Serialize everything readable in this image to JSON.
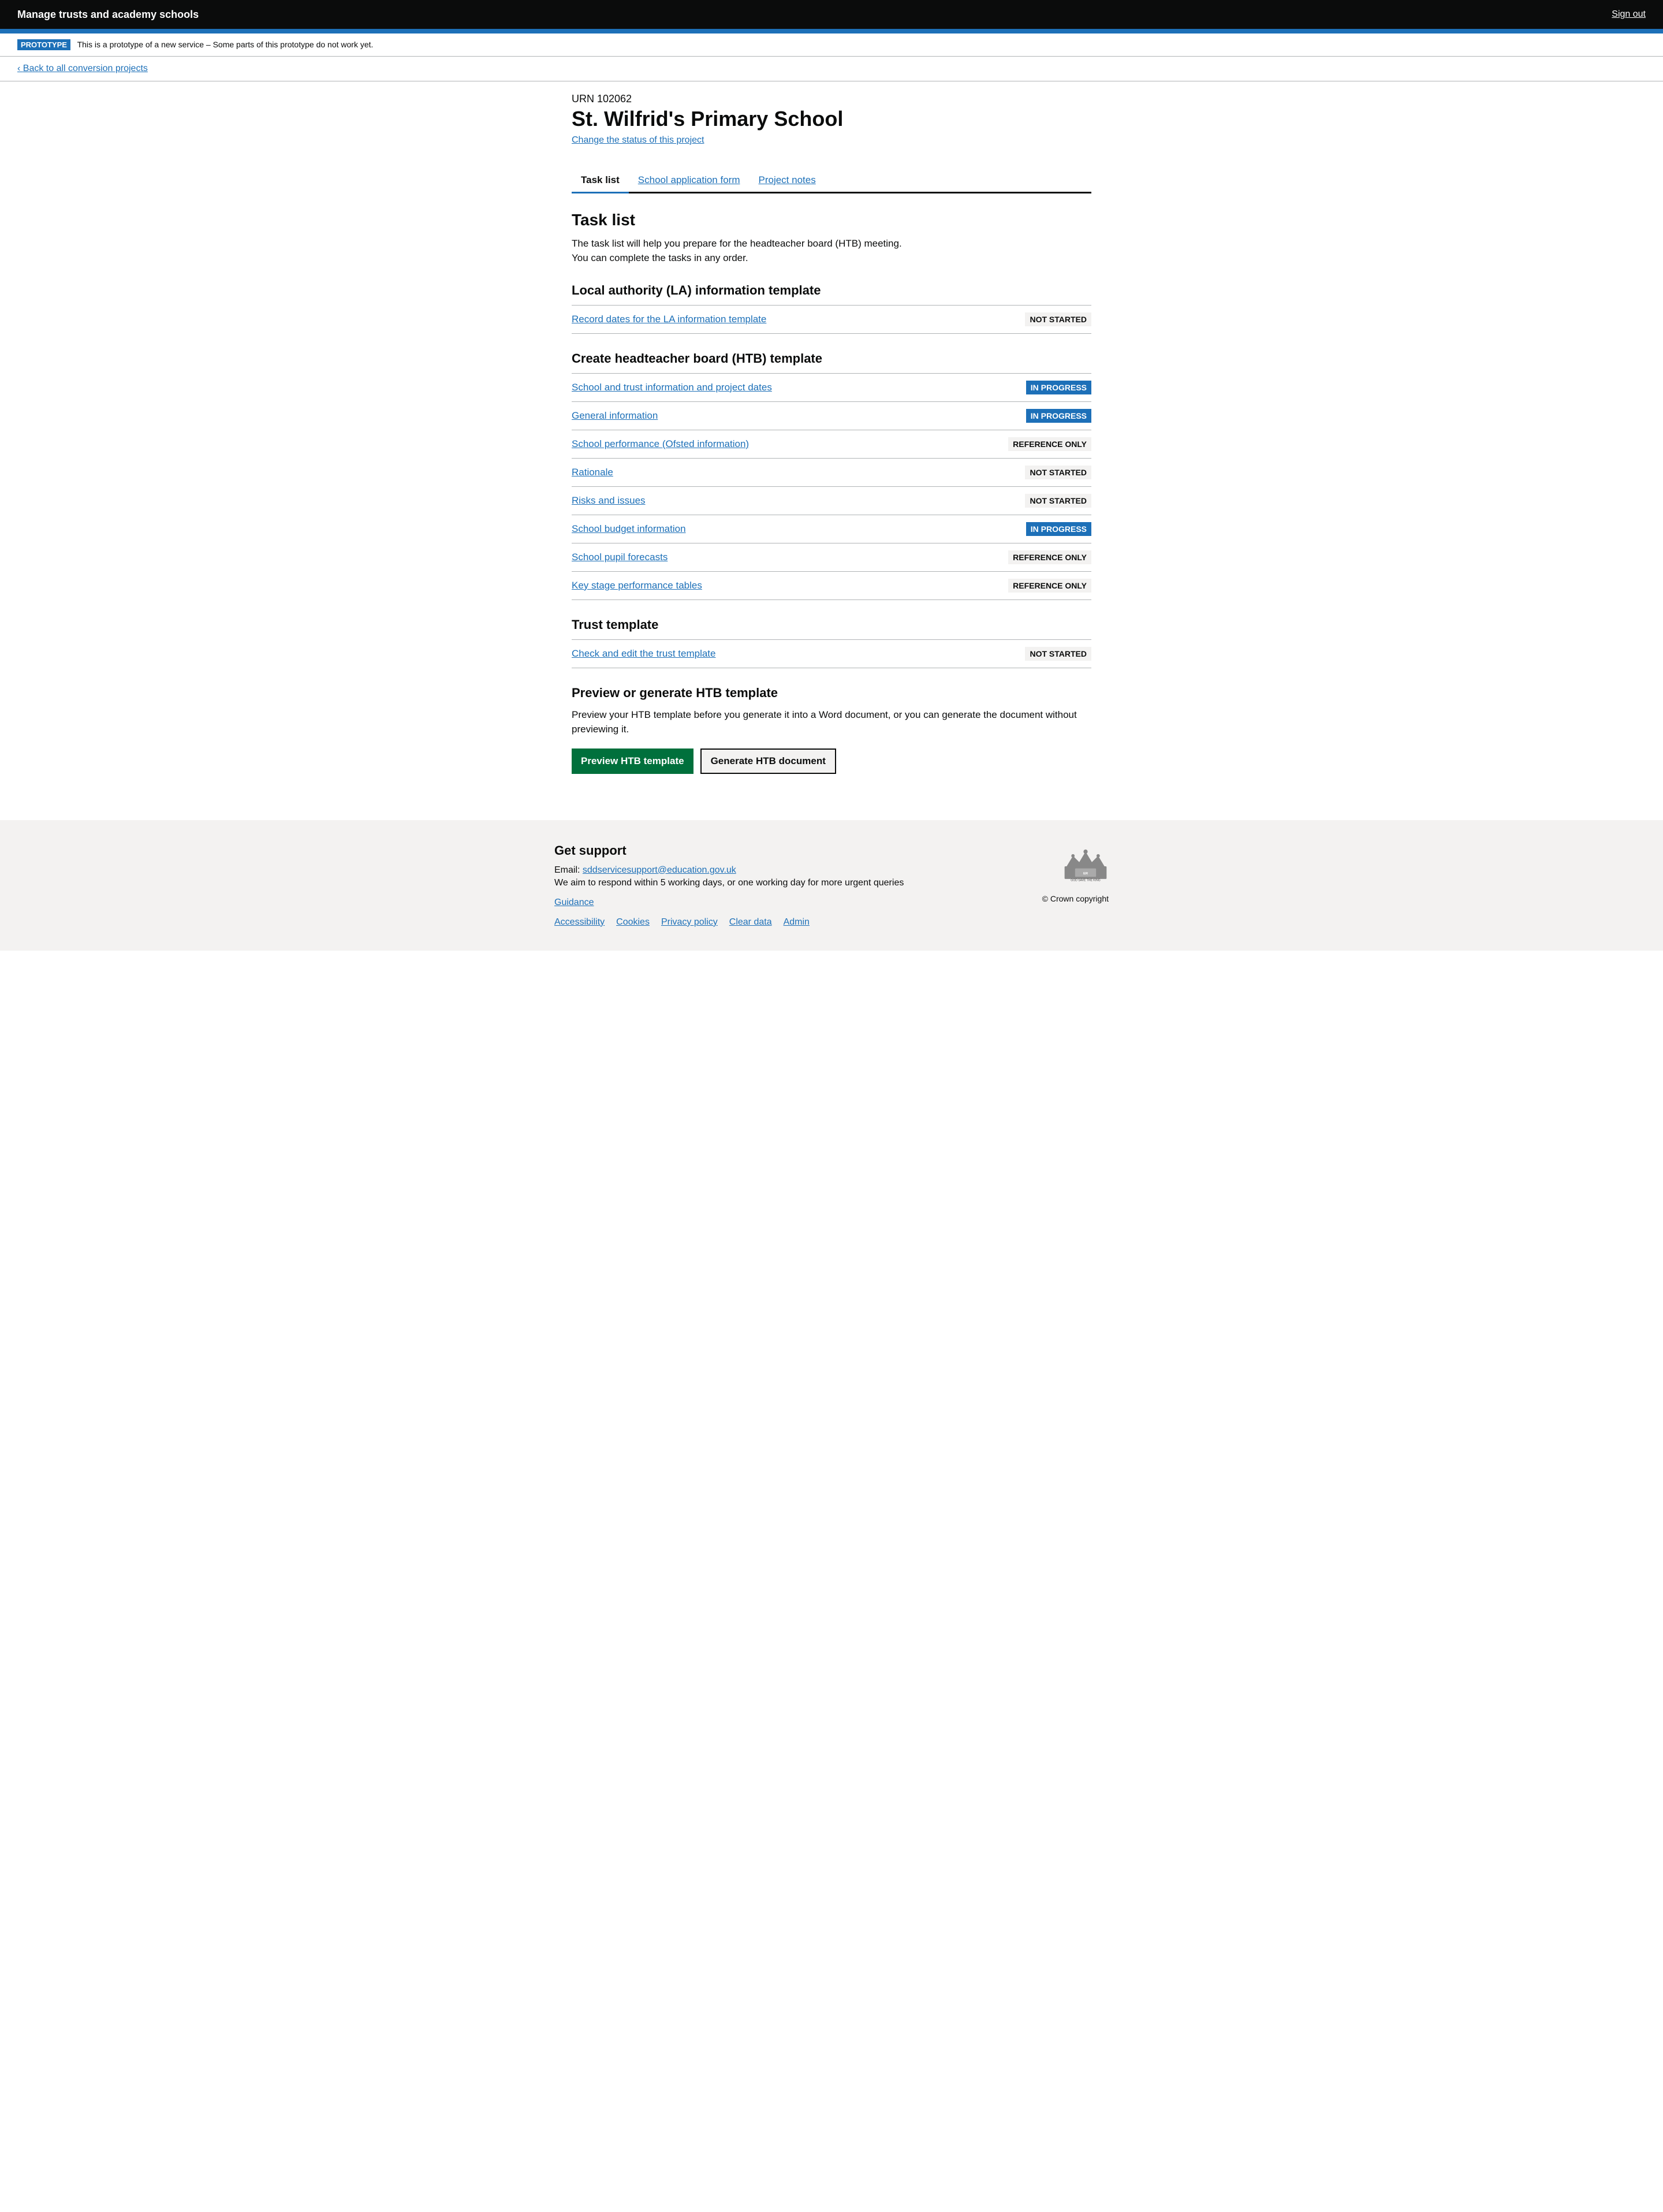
{
  "header": {
    "title": "Manage trusts and academy schools",
    "sign_out_label": "Sign out"
  },
  "prototype_banner": {
    "badge": "PROTOTYPE",
    "message": "This is a prototype of a new service – Some parts of this prototype do not work yet."
  },
  "back_link": {
    "label": "Back to all conversion projects"
  },
  "school": {
    "urn": "URN 102062",
    "name": "St. Wilfrid's Primary School",
    "change_status_label": "Change the status of this project"
  },
  "tabs": [
    {
      "label": "Task list",
      "active": true
    },
    {
      "label": "School application form",
      "active": false
    },
    {
      "label": "Project notes",
      "active": false
    }
  ],
  "task_list": {
    "title": "Task list",
    "description_line1": "The task list will help you prepare for the headteacher board (HTB) meeting.",
    "description_line2": "You can complete the tasks in any order.",
    "sections": [
      {
        "title": "Local authority (LA) information template",
        "tasks": [
          {
            "label": "Record dates for the LA information template",
            "status": "NOT STARTED",
            "status_type": "not-started"
          }
        ]
      },
      {
        "title": "Create headteacher board (HTB) template",
        "tasks": [
          {
            "label": "School and trust information and project dates",
            "status": "IN PROGRESS",
            "status_type": "in-progress"
          },
          {
            "label": "General information",
            "status": "IN PROGRESS",
            "status_type": "in-progress"
          },
          {
            "label": "School performance (Ofsted information)",
            "status": "REFERENCE ONLY",
            "status_type": "reference-only"
          },
          {
            "label": "Rationale",
            "status": "NOT STARTED",
            "status_type": "not-started"
          },
          {
            "label": "Risks and issues",
            "status": "NOT STARTED",
            "status_type": "not-started"
          },
          {
            "label": "School budget information",
            "status": "IN PROGRESS",
            "status_type": "in-progress"
          },
          {
            "label": "School pupil forecasts",
            "status": "REFERENCE ONLY",
            "status_type": "reference-only"
          },
          {
            "label": "Key stage performance tables",
            "status": "REFERENCE ONLY",
            "status_type": "reference-only"
          }
        ]
      },
      {
        "title": "Trust template",
        "tasks": [
          {
            "label": "Check and edit the trust template",
            "status": "NOT STARTED",
            "status_type": "not-started"
          }
        ]
      }
    ]
  },
  "preview_section": {
    "title": "Preview or generate HTB template",
    "description": "Preview your HTB template before you generate it into a Word document, or you can generate the document without previewing it.",
    "preview_button": "Preview HTB template",
    "generate_button": "Generate HTB document"
  },
  "footer": {
    "support_title": "Get support",
    "email_prefix": "Email: ",
    "email": "sddservicesupport@education.gov.uk",
    "response_time": "We aim to respond within 5 working days, or one working day for more urgent queries",
    "links": [
      {
        "label": "Guidance"
      },
      {
        "label": "Accessibility"
      },
      {
        "label": "Cookies"
      },
      {
        "label": "Privacy policy"
      },
      {
        "label": "Clear data"
      },
      {
        "label": "Admin"
      }
    ],
    "crown_copyright": "© Crown copyright"
  }
}
